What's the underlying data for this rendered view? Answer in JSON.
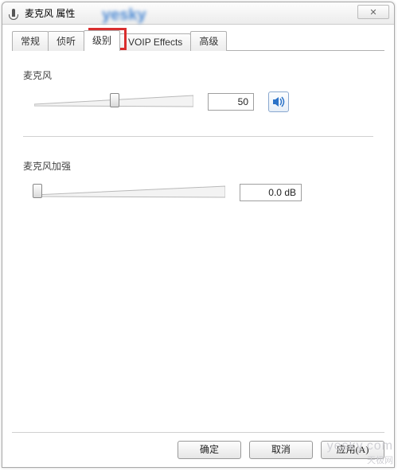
{
  "window": {
    "title": "麦克风 属性",
    "close_glyph": "✕"
  },
  "tabs": {
    "t0": "常规",
    "t1": "侦听",
    "t2": "级别",
    "t3": "VOIP Effects",
    "t4": "高级"
  },
  "mic": {
    "label": "麦克风",
    "value": "50",
    "thumb_percent": 50
  },
  "boost": {
    "label": "麦克风加强",
    "value": "0.0 dB",
    "thumb_percent": 0
  },
  "buttons": {
    "ok": "确定",
    "cancel": "取消",
    "apply": "应用(A)"
  },
  "watermark": {
    "top": "yesky",
    "br1": "yesky.com",
    "br2": "天极网"
  }
}
